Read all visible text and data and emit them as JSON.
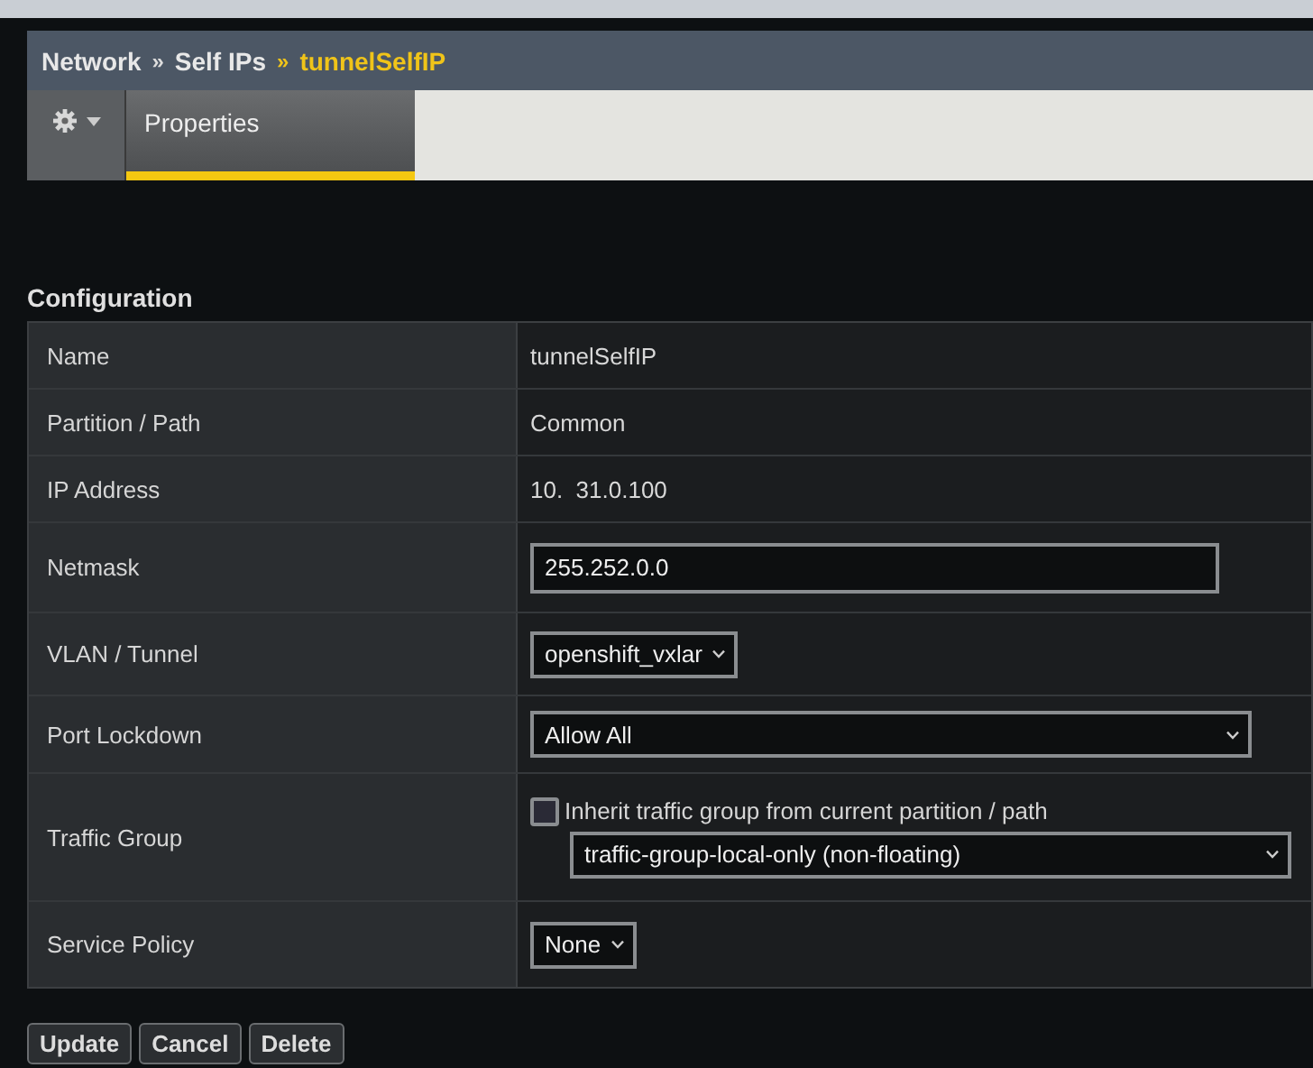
{
  "breadcrumb": {
    "items": [
      "Network",
      "Self IPs"
    ],
    "separator": "»",
    "current": "tunnelSelfIP"
  },
  "tabs": [
    {
      "label": "Properties",
      "selected": true
    }
  ],
  "section_title": "Configuration",
  "rows": [
    {
      "label": "Name",
      "kind": "text",
      "value": "tunnelSelfIP"
    },
    {
      "label": "Partition / Path",
      "kind": "text",
      "value": "Common"
    },
    {
      "label": "IP Address",
      "kind": "text",
      "value": "10.  31.0.100"
    },
    {
      "label": "Netmask",
      "kind": "input",
      "value": "255.252.0.0"
    },
    {
      "label": "VLAN / Tunnel",
      "kind": "select",
      "value": "openshift_vxlar"
    },
    {
      "label": "Port Lockdown",
      "kind": "wide-select",
      "value": "Allow All"
    },
    {
      "label": "Traffic Group",
      "kind": "traffic-group",
      "checkbox_label": "Inherit traffic group from current partition / path",
      "checked": false,
      "value": "traffic-group-local-only (non-floating)"
    },
    {
      "label": "Service Policy",
      "kind": "select",
      "value": "None"
    }
  ],
  "buttons": [
    "Update",
    "Cancel",
    "Delete"
  ]
}
